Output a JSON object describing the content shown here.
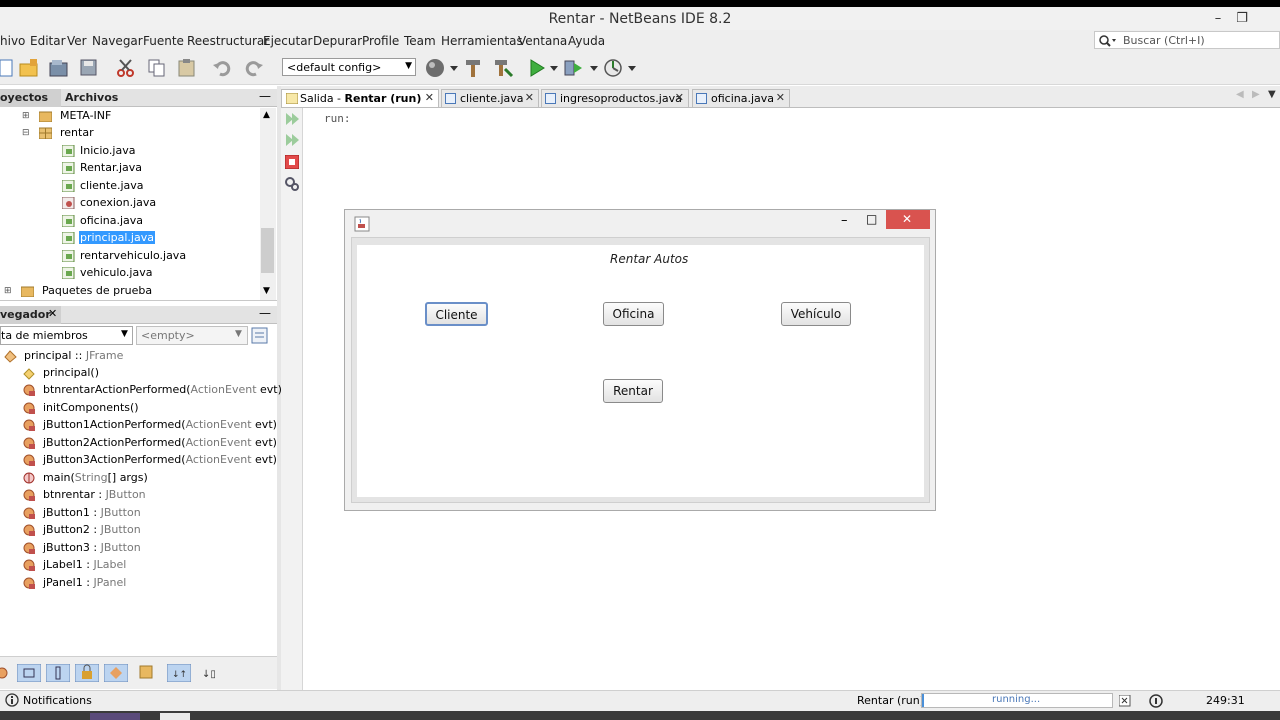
{
  "window": {
    "title": "Rentar - NetBeans IDE 8.2"
  },
  "menu": [
    "hivo",
    "Editar",
    "Ver",
    "Navegar",
    "Fuente",
    "Reestructurar",
    "Ejecutar",
    "Depurar",
    "Profile",
    "Team",
    "Herramientas",
    "Ventana",
    "Ayuda"
  ],
  "search": {
    "placeholder": "Buscar (Ctrl+I)"
  },
  "toolbar": {
    "config": "<default config>"
  },
  "projects": {
    "tabs": [
      "oyectos",
      "Archivos"
    ],
    "items": [
      {
        "label": "META-INF",
        "icon": "folder-icon"
      },
      {
        "label": "rentar",
        "icon": "package-icon"
      },
      {
        "label": "Inicio.java",
        "icon": "java-file-icon"
      },
      {
        "label": "Rentar.java",
        "icon": "java-file-icon"
      },
      {
        "label": "cliente.java",
        "icon": "java-file-icon"
      },
      {
        "label": "conexion.java",
        "icon": "java-class-icon"
      },
      {
        "label": "oficina.java",
        "icon": "java-file-icon"
      },
      {
        "label": "principal.java",
        "icon": "java-file-icon"
      },
      {
        "label": "rentarvehiculo.java",
        "icon": "java-file-icon"
      },
      {
        "label": "vehiculo.java",
        "icon": "java-file-icon"
      },
      {
        "label": "Paquetes de prueba",
        "icon": "folder-icon"
      }
    ]
  },
  "navigator": {
    "title": "vegador",
    "filter": "ta de miembros",
    "empty": "<empty>",
    "root": {
      "name": "principal",
      "sep": " :: ",
      "type": "JFrame"
    },
    "items": [
      {
        "name": "principal()",
        "type": ""
      },
      {
        "name": "btnrentarActionPerformed(",
        "type": "ActionEvent",
        "rest": " evt)"
      },
      {
        "name": "initComponents()",
        "type": ""
      },
      {
        "name": "jButton1ActionPerformed(",
        "type": "ActionEvent",
        "rest": " evt)"
      },
      {
        "name": "jButton2ActionPerformed(",
        "type": "ActionEvent",
        "rest": " evt)"
      },
      {
        "name": "jButton3ActionPerformed(",
        "type": "ActionEvent",
        "rest": " evt)"
      },
      {
        "name": "main(",
        "type": "String",
        "rest": "[] args)"
      },
      {
        "name": "btnrentar : ",
        "type": "JButton"
      },
      {
        "name": "jButton1 : ",
        "type": "JButton"
      },
      {
        "name": "jButton2 : ",
        "type": "JButton"
      },
      {
        "name": "jButton3 : ",
        "type": "JButton"
      },
      {
        "name": "jLabel1 : ",
        "type": "JLabel"
      },
      {
        "name": "jPanel1 : ",
        "type": "JPanel"
      }
    ]
  },
  "editor": {
    "tabs": [
      {
        "prefix": "Salida - ",
        "label": "Rentar (run)"
      },
      {
        "prefix": "",
        "label": "cliente.java"
      },
      {
        "prefix": "",
        "label": "ingresoproductos.java"
      },
      {
        "prefix": "",
        "label": "oficina.java"
      }
    ],
    "output": "run:"
  },
  "app": {
    "heading": "Rentar Autos",
    "buttons": {
      "cliente": "Cliente",
      "oficina": "Oficina",
      "vehiculo": "Vehículo",
      "rentar": "Rentar"
    }
  },
  "status": {
    "notifications": "Notifications",
    "task": "Rentar (run)",
    "progress": "running...",
    "position": "249:31"
  },
  "colors": {
    "selection": "#3399ff",
    "close_red": "#d9534f",
    "accent_blue": "#4a90d9"
  }
}
